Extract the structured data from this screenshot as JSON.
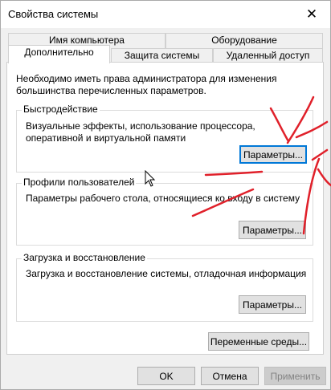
{
  "window": {
    "title": "Свойства системы",
    "close_glyph": "✕"
  },
  "tabs": {
    "back_row": [
      "Имя компьютера",
      "Оборудование"
    ],
    "front_row": [
      "Дополнительно",
      "Защита системы",
      "Удаленный доступ"
    ],
    "active": "Дополнительно"
  },
  "panel": {
    "note": "Необходимо иметь права администратора для изменения большинства перечисленных параметров.",
    "performance": {
      "title": "Быстродействие",
      "description": "Визуальные эффекты, использование процессора, оперативной и виртуальной памяти",
      "button": "Параметры..."
    },
    "profiles": {
      "title": "Профили пользователей",
      "description": "Параметры рабочего стола, относящиеся ко входу в систему",
      "button": "Параметры..."
    },
    "startup": {
      "title": "Загрузка и восстановление",
      "description": "Загрузка и восстановление системы, отладочная информация",
      "button": "Параметры..."
    },
    "env_button": "Переменные среды..."
  },
  "footer": {
    "ok": "OK",
    "cancel": "Отмена",
    "apply": "Применить"
  },
  "colors": {
    "focus_border": "#0078d7",
    "annotation": "#e0202a"
  }
}
